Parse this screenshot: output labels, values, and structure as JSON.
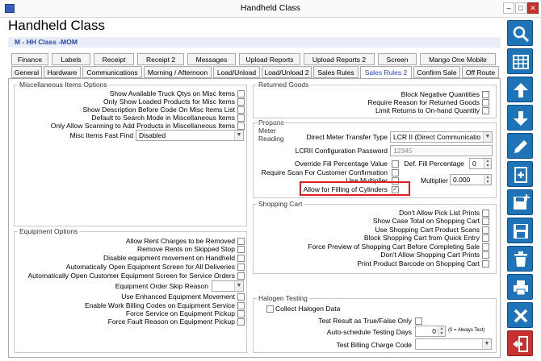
{
  "window": {
    "title": "Handheld Class",
    "minimize": "–",
    "maximize": "□",
    "close": "✕"
  },
  "page": {
    "heading": "Handheld Class",
    "class_code": "M - HH Class -MOM"
  },
  "tabs_row1": [
    "Finance",
    "Labels",
    "Receipt",
    "Receipt 2",
    "Messages",
    "Upload Reports",
    "Upload Reports 2",
    "Screen",
    "Mango One Mobile"
  ],
  "tabs_row2": [
    "General",
    "Hardware",
    "Communications",
    "Morning / Afternoon",
    "Load/Unload",
    "Load/Unload 2",
    "Sales Rules",
    "Sales Rules 2",
    "Confirm Sale",
    "Off Route"
  ],
  "active_tab": "Sales Rules 2",
  "misc": {
    "title": "Miscellaneous Items Options",
    "options": [
      "Show Available Truck Qtys on Misc Items",
      "Only Show Loaded Products for Misc Items",
      "Show Description Before Code On Misc Items List",
      "Default to Search Mode in Miscellaneous Items",
      "Only Allow Scanning to Add Products in Miscellaneous Items"
    ],
    "fast_find_label": "Misc Items Fast Find",
    "fast_find_value": "Disabled"
  },
  "equipment": {
    "title": "Equipment Options",
    "options_a": [
      "Allow Rent Charges to be Removed",
      "Remove Rents on Skipped Stop",
      "Disable equipment movement on Handheld",
      "Automatically Open Equipment Screen for All Deliveries",
      "Automatically Open Customer Equipment Screen for Service Orders"
    ],
    "order_skip_label": "Equipment Order Skip Reason",
    "order_skip_value": "",
    "options_b": [
      "Use Enhanced Equipment Movement",
      "Enable Work Billing Codes on Equipment Service",
      "Force Service on Equipment Pickup",
      "Force Fault Reason on Equipment Pickup"
    ]
  },
  "returned": {
    "title": "Returned Goods",
    "options": [
      "Block Negative Quantities",
      "Require Reason for Returned Goods",
      "Limit Returns to On-hand Quantity"
    ]
  },
  "propane": {
    "title": "Propane Meter Reading",
    "transfer_label": "Direct Meter Transfer Type",
    "transfer_value": "LCR II (Direct Communicatio",
    "password_label": "LCRII Configuration Password",
    "password_value": "12345",
    "override_label": "Override Fill Percentage Value",
    "def_fill_label": "Def. Fill Percentage",
    "def_fill_value": "0",
    "scan_label": "Require Scan For Customer Confirmation",
    "multiplier_check_label": "Use Multiplier",
    "multiplier_label": "Multiplier",
    "multiplier_value": "0.000",
    "cylinders_label": "Allow for Filling of Cylinders",
    "cylinders_checked": true
  },
  "cart": {
    "title": "Shopping Cart",
    "options": [
      "Don't Allow Pick List Prints",
      "Show Case Total on Shopping Cart",
      "Use Shopping Cart Product Scans",
      "Block Shopping Cart from Quick Entry",
      "Force Preview of Shopping Cart Before Completing Sale",
      "Don't Allow Shopping Cart Prints",
      "Print Product Barcode on Shopping Cart"
    ]
  },
  "halogen": {
    "title": "Halogen Testing",
    "collect_label": "Collect Halogen Data",
    "truefalse_label": "Test Result as True/False Only",
    "days_label": "Auto-schedule Testing Days",
    "days_value": "0",
    "days_note": "(0 = Always Test)",
    "billing_label": "Test Billing Charge Code",
    "billing_value": ""
  },
  "sidebar": [
    "search-icon",
    "grid-icon",
    "up-arrow-icon",
    "down-arrow-icon",
    "edit-icon",
    "add-copy-icon",
    "save-new-icon",
    "save-icon",
    "delete-icon",
    "print-icon",
    "cancel-icon",
    "exit-icon"
  ],
  "colors": {
    "sidebar_button": "#1f73b7",
    "exit_button": "#c73130",
    "highlight_box": "#e02020",
    "active_tab_text": "#2246c0"
  }
}
